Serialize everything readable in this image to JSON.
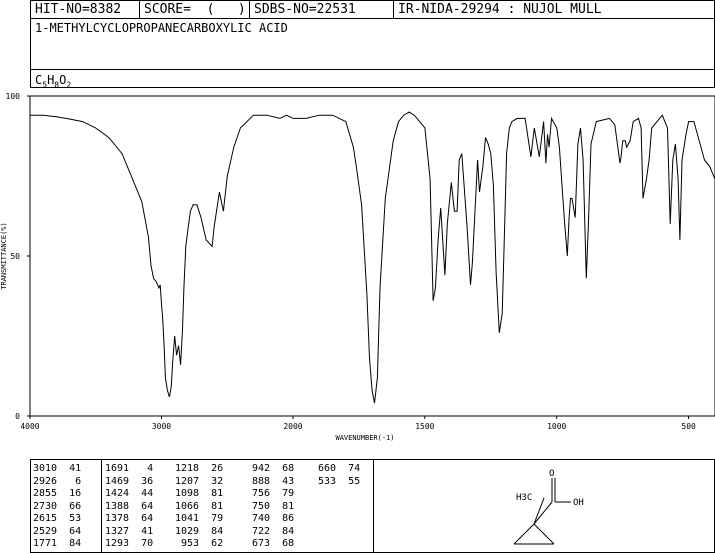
{
  "header": {
    "hit_no": "HIT-NO=8382",
    "score": "SCORE=  (   )",
    "sdbs_no": "SDBS-NO=22531",
    "ir_info": "IR-NIDA-29294 : NUJOL MULL"
  },
  "compound": {
    "name": "1-METHYLCYCLOPROPANECARBOXYLIC ACID",
    "formula_parts": [
      "C",
      "5",
      "H",
      "8",
      "O",
      "2"
    ]
  },
  "structure_labels": {
    "methyl": "H3C",
    "carbonyl_o": "O",
    "hydroxyl": "OH"
  },
  "chart_data": {
    "type": "line",
    "xlabel": "WAVENUMBER(-1)",
    "ylabel": "TRANSMITTANCE(%)",
    "xlim": [
      4000,
      400
    ],
    "ylim": [
      0,
      100
    ],
    "x_ticks": [
      4000,
      3000,
      2000,
      1500,
      1000,
      500
    ],
    "y_ticks": [
      0,
      50,
      100
    ],
    "series": [
      {
        "x": [
          4000,
          3900,
          3800,
          3700,
          3600,
          3500,
          3400,
          3300,
          3200,
          3150,
          3100,
          3080,
          3060,
          3040,
          3020,
          3010,
          3000,
          2990,
          2980,
          2970,
          2955,
          2940,
          2926,
          2915,
          2900,
          2885,
          2870,
          2855,
          2840,
          2830,
          2815,
          2800,
          2780,
          2760,
          2730,
          2700,
          2660,
          2615,
          2600,
          2560,
          2529,
          2500,
          2450,
          2400,
          2300,
          2200,
          2100,
          2050,
          2000,
          1950,
          1900,
          1850,
          1800,
          1771,
          1760,
          1740,
          1720,
          1710,
          1700,
          1691,
          1680,
          1670,
          1650,
          1620,
          1600,
          1580,
          1560,
          1540,
          1500,
          1480,
          1469,
          1460,
          1450,
          1440,
          1424,
          1415,
          1400,
          1388,
          1378,
          1370,
          1360,
          1340,
          1327,
          1320,
          1300,
          1293,
          1280,
          1270,
          1260,
          1250,
          1240,
          1230,
          1218,
          1207,
          1200,
          1190,
          1180,
          1170,
          1150,
          1120,
          1098,
          1085,
          1066,
          1050,
          1041,
          1035,
          1029,
          1020,
          1000,
          990,
          980,
          970,
          960,
          953,
          948,
          942,
          930,
          920,
          910,
          900,
          888,
          880,
          870,
          850,
          800,
          780,
          760,
          756,
          750,
          740,
          735,
          722,
          710,
          690,
          680,
          673,
          660,
          650,
          640,
          620,
          600,
          580,
          570,
          560,
          550,
          540,
          533,
          525,
          510,
          500,
          480,
          460,
          440,
          420,
          400
        ],
        "y": [
          94,
          94,
          93.5,
          92.8,
          92,
          90,
          87,
          82,
          72,
          67,
          56,
          47,
          43,
          42,
          40,
          41,
          35,
          30,
          22,
          12,
          8,
          6,
          9,
          17,
          25,
          19,
          22,
          16,
          27,
          40,
          53,
          58,
          64,
          66,
          66,
          62,
          55,
          53,
          59,
          70,
          64,
          75,
          84,
          90,
          94,
          94,
          93,
          94,
          93,
          93,
          94,
          94,
          92,
          84,
          78,
          66,
          38,
          18,
          8,
          4,
          12,
          40,
          68,
          86,
          92,
          94,
          95,
          94,
          90,
          74,
          36,
          40,
          55,
          65,
          44,
          60,
          73,
          64,
          64,
          80,
          82,
          59,
          41,
          48,
          80,
          70,
          78,
          87,
          85,
          82,
          72,
          45,
          26,
          32,
          52,
          82,
          90,
          92,
          93,
          93,
          81,
          90,
          81,
          92,
          79,
          88,
          84,
          93,
          90,
          84,
          72,
          60,
          50,
          62,
          68,
          68,
          62,
          85,
          90,
          80,
          43,
          60,
          85,
          92,
          93,
          91,
          79,
          81,
          86,
          86,
          84,
          86,
          92,
          93,
          90,
          68,
          74,
          80,
          90,
          92,
          94,
          90,
          60,
          80,
          85,
          74,
          55,
          80,
          88,
          92,
          92,
          86,
          80,
          78,
          74
        ]
      }
    ],
    "peaks": [
      {
        "wavenumber": 3010,
        "transmittance": 41
      },
      {
        "wavenumber": 2926,
        "transmittance": 6
      },
      {
        "wavenumber": 2855,
        "transmittance": 16
      },
      {
        "wavenumber": 2730,
        "transmittance": 66
      },
      {
        "wavenumber": 2615,
        "transmittance": 53
      },
      {
        "wavenumber": 2529,
        "transmittance": 64
      },
      {
        "wavenumber": 1771,
        "transmittance": 84
      },
      {
        "wavenumber": 1691,
        "transmittance": 4
      },
      {
        "wavenumber": 1469,
        "transmittance": 36
      },
      {
        "wavenumber": 1424,
        "transmittance": 44
      },
      {
        "wavenumber": 1388,
        "transmittance": 64
      },
      {
        "wavenumber": 1378,
        "transmittance": 64
      },
      {
        "wavenumber": 1327,
        "transmittance": 41
      },
      {
        "wavenumber": 1293,
        "transmittance": 70
      },
      {
        "wavenumber": 1218,
        "transmittance": 26
      },
      {
        "wavenumber": 1207,
        "transmittance": 32
      },
      {
        "wavenumber": 1098,
        "transmittance": 81
      },
      {
        "wavenumber": 1066,
        "transmittance": 81
      },
      {
        "wavenumber": 1041,
        "transmittance": 79
      },
      {
        "wavenumber": 1029,
        "transmittance": 84
      },
      {
        "wavenumber": 953,
        "transmittance": 62
      },
      {
        "wavenumber": 942,
        "transmittance": 68
      },
      {
        "wavenumber": 888,
        "transmittance": 43
      },
      {
        "wavenumber": 756,
        "transmittance": 79
      },
      {
        "wavenumber": 750,
        "transmittance": 81
      },
      {
        "wavenumber": 740,
        "transmittance": 86
      },
      {
        "wavenumber": 722,
        "transmittance": 84
      },
      {
        "wavenumber": 673,
        "transmittance": 68
      },
      {
        "wavenumber": 660,
        "transmittance": 74
      },
      {
        "wavenumber": 533,
        "transmittance": 55
      }
    ]
  }
}
